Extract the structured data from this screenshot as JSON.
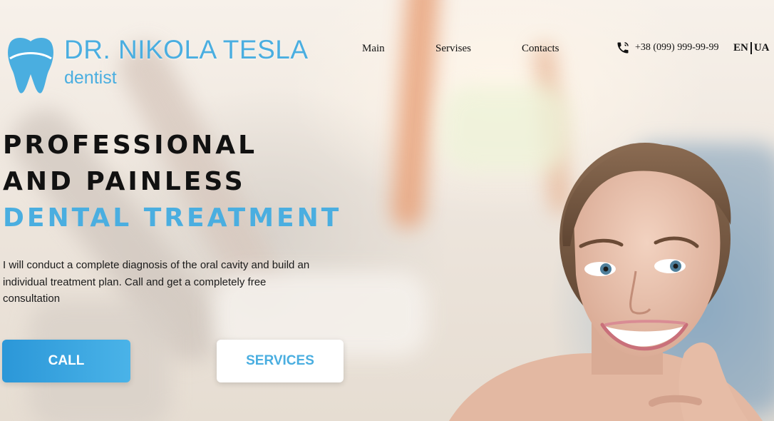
{
  "header": {
    "brand_name": "DR. NIKOLA TESLA",
    "brand_subtitle": "dentist",
    "nav": {
      "main": "Main",
      "services": "Servises",
      "contacts": "Contacts"
    },
    "phone": "+38 (099) 999-99-99",
    "phone_icon": "phone-icon",
    "logo_icon": "tooth-icon",
    "languages": [
      "EN",
      "UA"
    ]
  },
  "hero": {
    "title_line1": "PROFESSIONAL",
    "title_line2": "AND PAINLESS",
    "title_accent": "DENTAL TREATMENT",
    "description": "I will conduct a complete diagnosis of the oral cavity and build an individual treatment plan. Call and get a completely free consultation",
    "call_label": "CALL",
    "services_label": "SERVICES"
  },
  "colors": {
    "accent": "#4aaee0",
    "button_gradient_start": "#2b97d8",
    "text": "#111111"
  }
}
